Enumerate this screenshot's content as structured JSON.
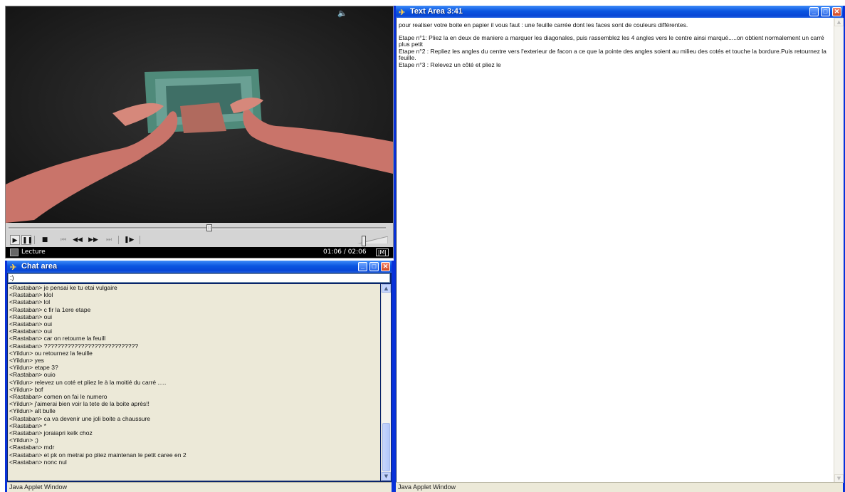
{
  "player": {
    "status_label": "Lecture",
    "time": "01:06 / 02:06",
    "corner_label": "|M|",
    "controls": [
      {
        "name": "play-button",
        "glyph": "▶",
        "dim": false,
        "box": true
      },
      {
        "name": "pause-button",
        "glyph": "❚❚",
        "dim": false,
        "box": true
      },
      {
        "name": "stop-button",
        "glyph": "■",
        "dim": false,
        "box": false
      },
      {
        "name": "previous-button",
        "glyph": "⏮",
        "dim": true,
        "box": false
      },
      {
        "name": "rewind-button",
        "glyph": "◀◀",
        "dim": false,
        "box": false
      },
      {
        "name": "fast-forward-button",
        "glyph": "▶▶",
        "dim": false,
        "box": false
      },
      {
        "name": "next-button",
        "glyph": "⏭",
        "dim": true,
        "box": false
      },
      {
        "name": "step-button",
        "glyph": "❚▶",
        "dim": false,
        "box": false
      }
    ],
    "volume_icon": "🔈"
  },
  "chat": {
    "title": "Chat area",
    "input_value": ":)",
    "status": "Java Applet Window",
    "messages": [
      "<Rastaban> je pensai ke tu etai vulgaire",
      "<Rastaban> klol",
      "<Rastaban> lol",
      "<Rastaban> c fir la 1ere etape",
      "<Rastaban> oui",
      "<Rastaban> oui",
      "<Rastaban> oui",
      "<Rastaban> car on retourne la feuill",
      "<Rastaban> ????????????????????????????",
      "<Yildun> ou retournez la feuille",
      "<Yildun> yes",
      "<Yildun> etape 3?",
      "<Rastaban> ouio",
      "<Yildun> relevez un coté et pliez le à la moitié du carré .....",
      "<Yildun> bof",
      "<Rastaban> comen on fai le numero",
      "<Yildun> j'aimerai bien voir la tete de la boite après!!",
      "<Yildun> alt bulle",
      "<Rastaban> ca va devenir une joli boite a chaussure",
      "<Rastaban> *",
      "<Rastaban> joraiapri kelk choz",
      "<Yildun> ;)",
      "<Rastaban> mdr",
      "<Rastaban> et pk on metrai po pliez maintenan le petit caree en 2",
      "<Rastaban> nonc nul"
    ]
  },
  "textarea": {
    "title": "Text Area 3:41",
    "status": "Java Applet Window",
    "intro": "pour realiser votre boite en papier il vous faut : une feuille carrée dont les faces sont de couleurs différentes.",
    "step1": "Etape n°1: Pliez la en deux de maniere a marquer les diagonales, puis rassemblez les 4 angles vers le centre ainsi marqué.....on obtient normalement un carré plus petit",
    "step2": "Etape n°2 : Repliez les angles du centre vers l'exterieur de facon a ce que la pointe des angles soient au milieu des cotés  et touche la bordure.Puis retournez la feuille.",
    "step3": "Etape n°3 : Relevez un côté et pliez le"
  },
  "window_buttons": {
    "minimize": "_",
    "maximize": "□",
    "close": "✕"
  },
  "title_icon": "✈",
  "colors": {
    "titlebar": "#0a55e0",
    "applet_bg": "#ece9d8",
    "video_bg": "#1e1e1e"
  }
}
